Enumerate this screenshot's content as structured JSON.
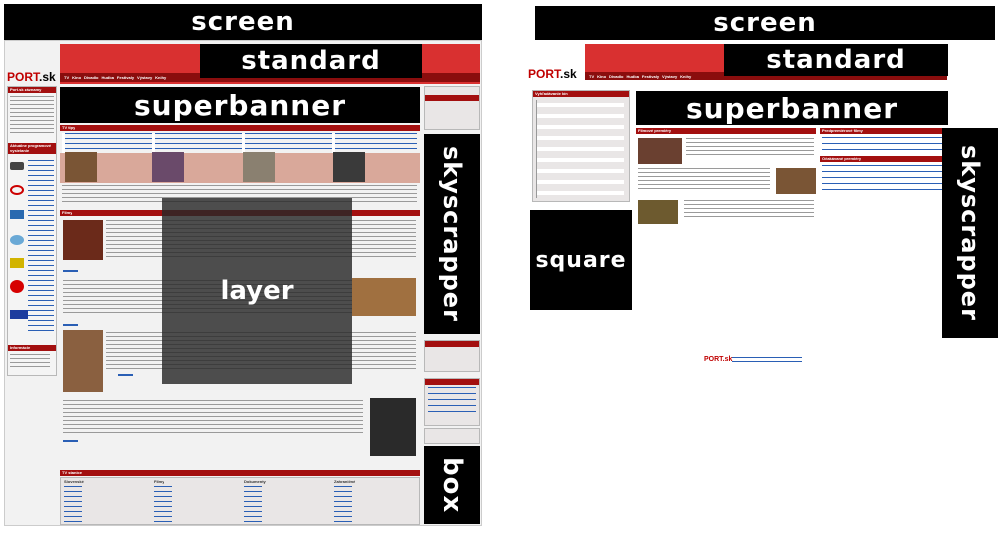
{
  "left": {
    "screen_label": "screen",
    "standard_label": "standard",
    "superbanner_label": "superbanner",
    "skyscrapper_label": "skyscrapper",
    "layer_label": "layer",
    "box_label": "box",
    "logo_main": "PORT",
    "logo_suffix": ".sk",
    "nav_items": [
      "TV",
      "Kino",
      "Divadlo",
      "Hudba",
      "Festivaly",
      "Výstavy",
      "Knihy"
    ],
    "sidebar_titles": [
      "Port.sk záznamy",
      "Aktuálne programové vysielanie",
      "Informácie"
    ],
    "section_titles": [
      "TV tipy",
      "Filmy",
      "TV stanice"
    ],
    "footer_columns": [
      "Slovenské",
      "Filmy",
      "Dokumenty",
      "Zahraničné"
    ]
  },
  "right": {
    "screen_label": "screen",
    "standard_label": "standard",
    "superbanner_label": "superbanner",
    "skyscrapper_label": "skyscrapper",
    "square_label": "square",
    "logo_main": "PORT",
    "logo_suffix": ".sk",
    "nav_items": [
      "TV",
      "Kino",
      "Divadlo",
      "Hudba",
      "Festivaly",
      "Výstavy",
      "Knihy"
    ],
    "panel_titles": [
      "Vyhľadávanie kín",
      "Filmové premiéry",
      "Predpremiérové filmy",
      "Očakávané premiéry"
    ],
    "footer_logo": "PORT.sk"
  }
}
